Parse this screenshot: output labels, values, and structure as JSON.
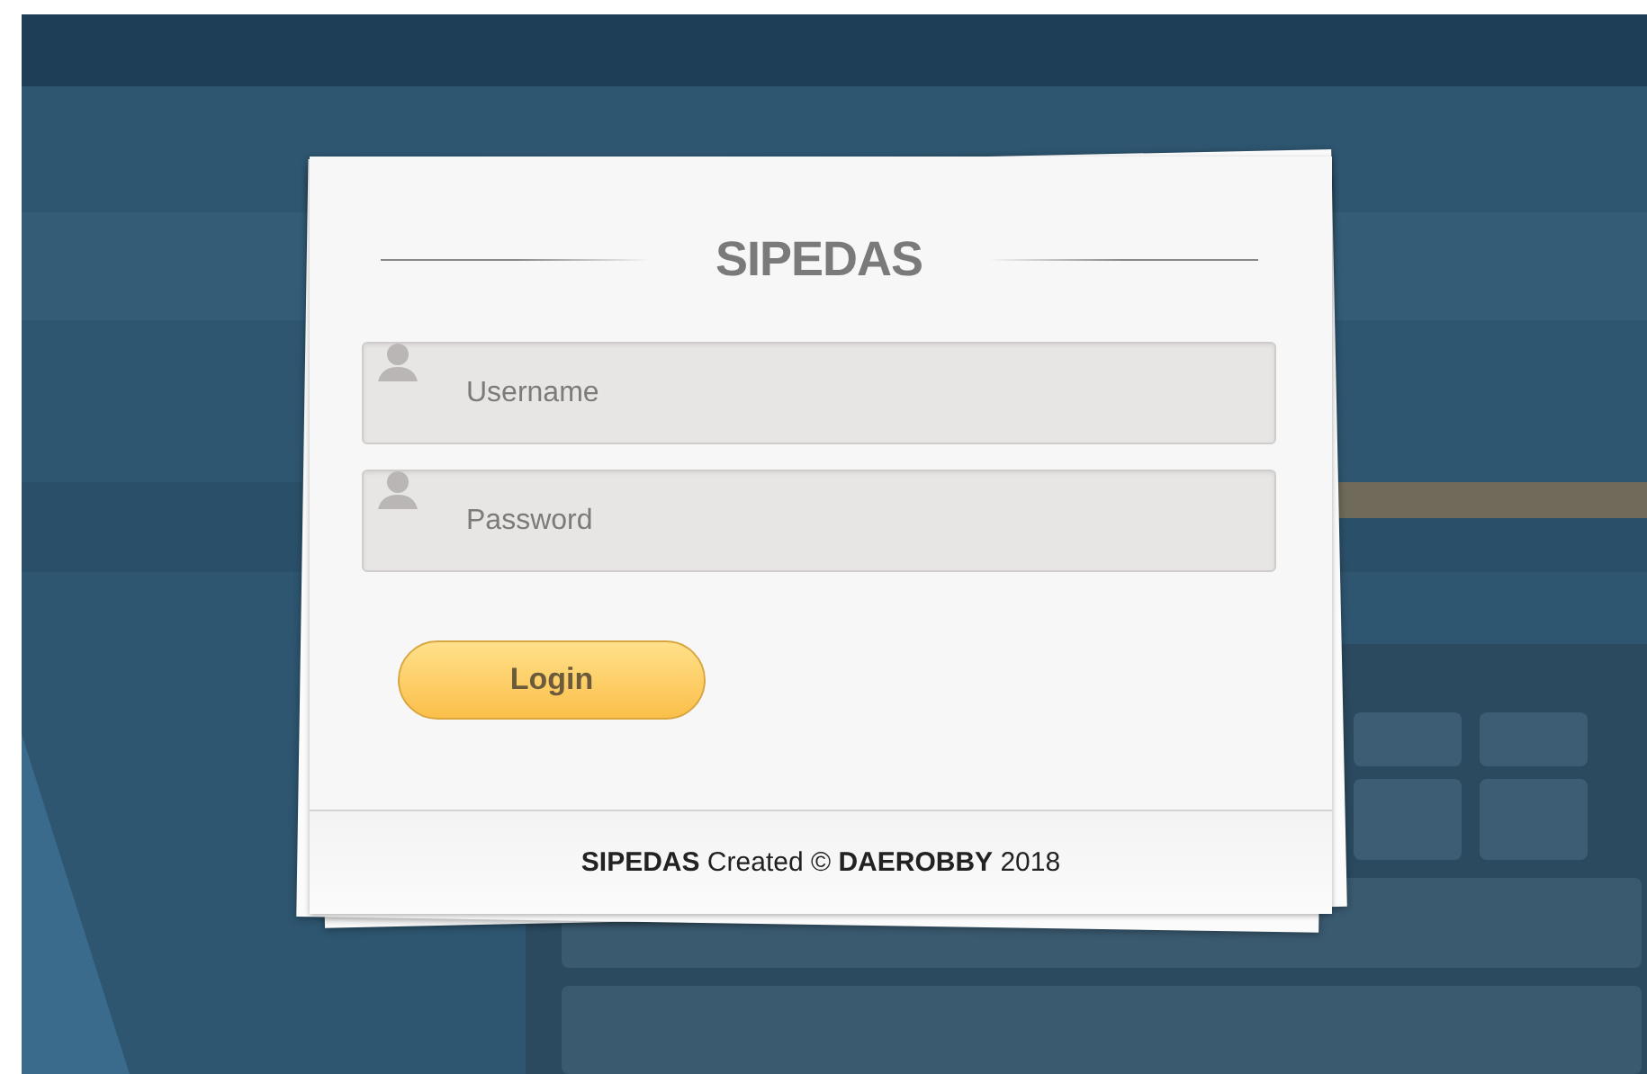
{
  "login_card": {
    "title": "SIPEDAS",
    "fields": [
      {
        "placeholder": "Username"
      },
      {
        "placeholder": "Password"
      }
    ],
    "button": "Login",
    "footer": "**SIPEDAS** Created © **DAEROBBY** 2018"
  }
}
